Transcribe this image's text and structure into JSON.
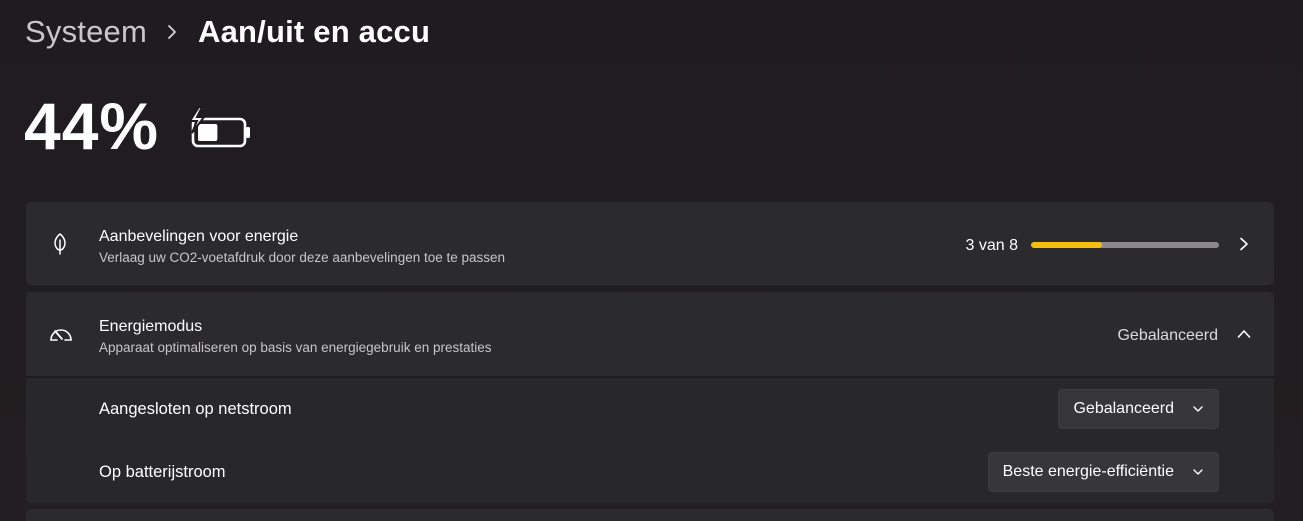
{
  "breadcrumb": {
    "parent": "Systeem",
    "current": "Aan/uit en accu"
  },
  "battery": {
    "percent_text": "44%",
    "charge_level": 0.44,
    "charging": true,
    "icon": "battery-charging-icon"
  },
  "recommendations": {
    "icon": "leaf-icon",
    "title": "Aanbevelingen voor energie",
    "subtitle": "Verlaag uw CO2-voetafdruk door deze aanbevelingen toe te passen",
    "progress_text": "3 van 8",
    "progress_done": 3,
    "progress_total": 8,
    "accent": "#f5bd10"
  },
  "power_mode": {
    "icon": "gauge-icon",
    "title": "Energiemodus",
    "subtitle": "Apparaat optimaliseren op basis van energiegebruik en prestaties",
    "current_value": "Gebalanceerd",
    "expanded": true,
    "settings": [
      {
        "label": "Aangesloten op netstroom",
        "value": "Gebalanceerd"
      },
      {
        "label": "Op batterijstroom",
        "value": "Beste energie-efficiëntie"
      }
    ]
  }
}
